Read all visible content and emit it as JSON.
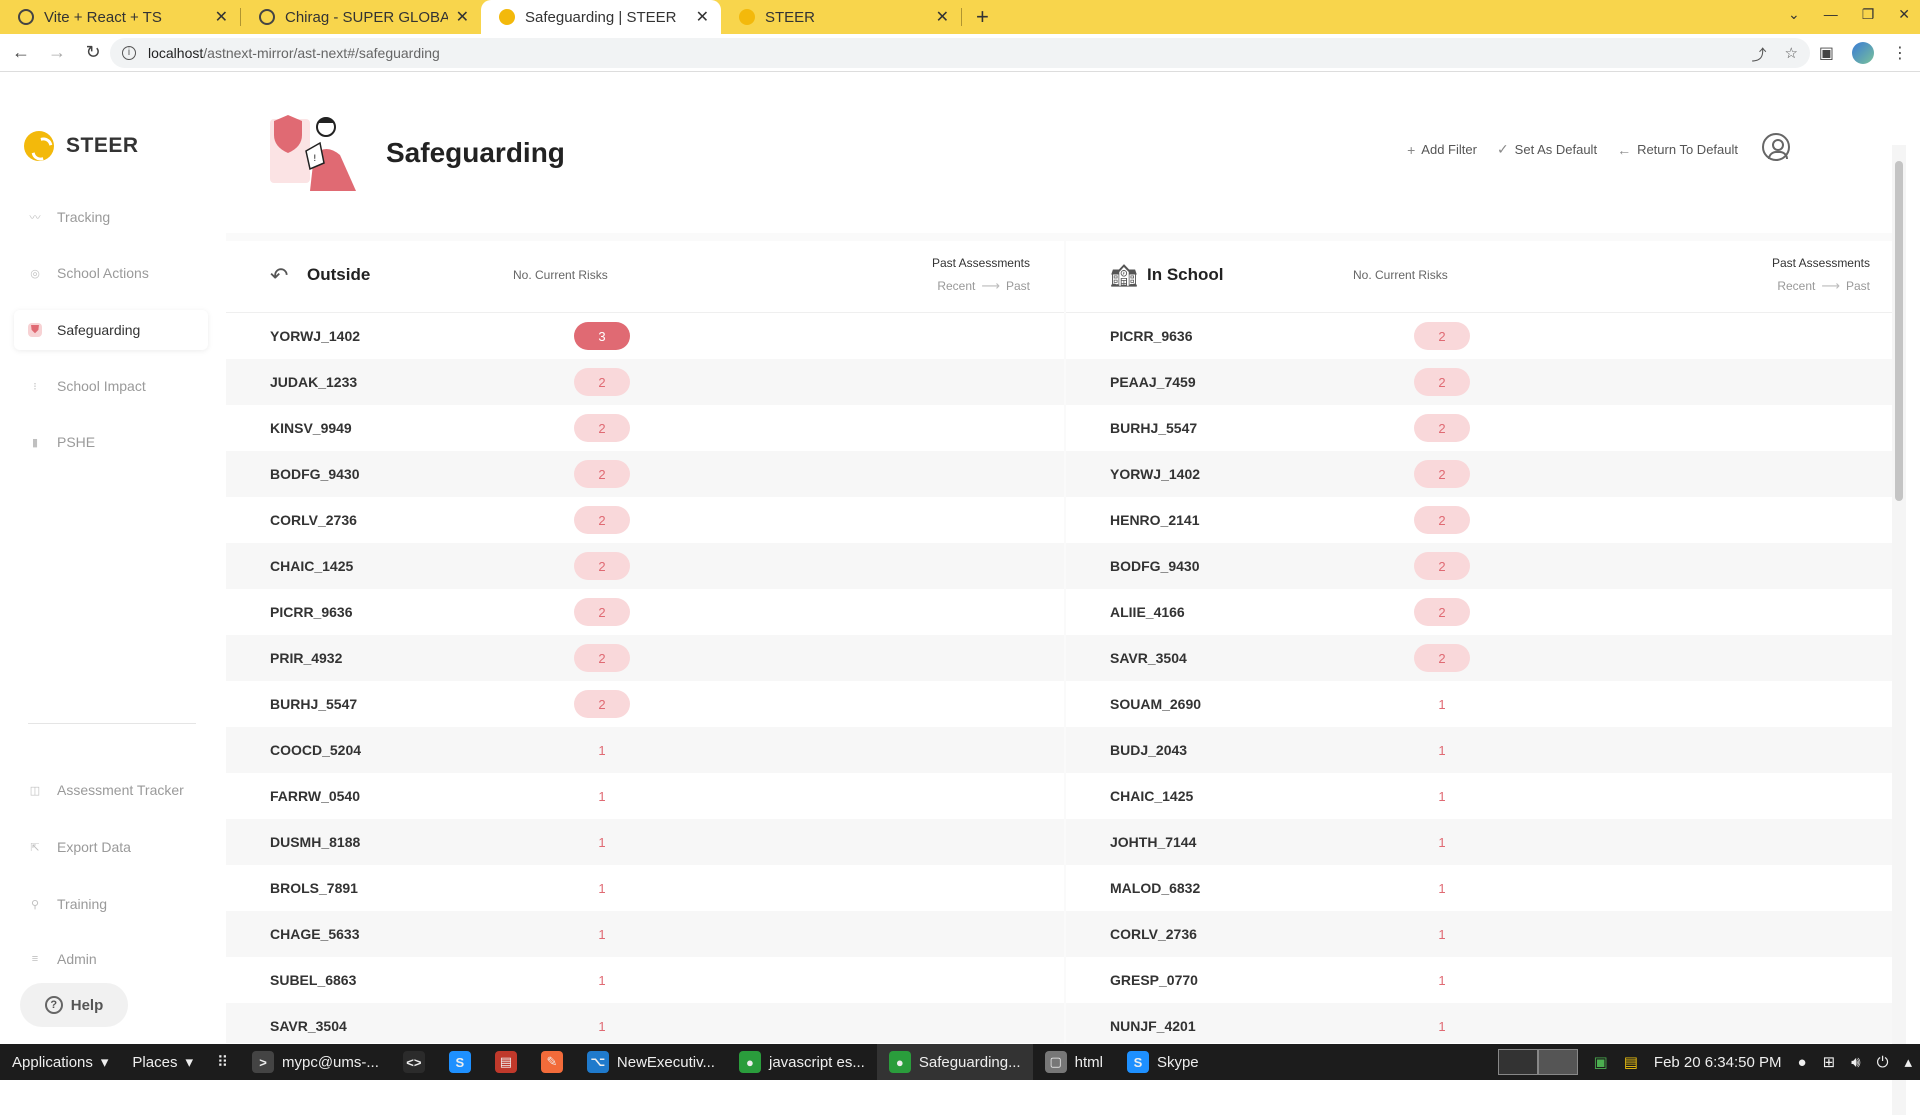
{
  "browser": {
    "tabs": [
      {
        "title": "Vite + React + TS",
        "icon": "globe-icon",
        "active": false
      },
      {
        "title": "Chirag - SUPER GLOBAL A",
        "icon": "globe-icon",
        "active": false
      },
      {
        "title": "Safeguarding | STEER",
        "icon": "steer-icon",
        "active": true
      },
      {
        "title": "STEER",
        "icon": "steer-icon",
        "active": false
      }
    ],
    "url_host": "localhost",
    "url_path": "/astnext-mirror/ast-next#/safeguarding"
  },
  "app": {
    "logo_text": "STEER",
    "nav_top": [
      {
        "label": "Tracking",
        "icon": "tracking-icon",
        "active": false
      },
      {
        "label": "School Actions",
        "icon": "target-icon",
        "active": false
      },
      {
        "label": "Safeguarding",
        "icon": "shield-icon",
        "active": true
      },
      {
        "label": "School Impact",
        "icon": "chart-icon",
        "active": false
      },
      {
        "label": "PSHE",
        "icon": "book-icon",
        "active": false
      }
    ],
    "nav_bottom": [
      {
        "label": "Assessment Tracker",
        "icon": "tracker-icon"
      },
      {
        "label": "Export Data",
        "icon": "export-icon"
      },
      {
        "label": "Training",
        "icon": "training-icon"
      },
      {
        "label": "Admin",
        "icon": "menu-icon"
      }
    ],
    "help_label": "Help"
  },
  "page": {
    "title": "Safeguarding",
    "actions": {
      "add_filter": "Add Filter",
      "set_default": "Set As Default",
      "return_default": "Return To Default"
    }
  },
  "panels": {
    "outside": {
      "title": "Outside",
      "current_risks_label": "No. Current Risks",
      "past_label": "Past Assessments",
      "recent_label": "Recent",
      "past_sub_label": "Past",
      "rows": [
        {
          "code": "YORWJ_1402",
          "risks": "3"
        },
        {
          "code": "JUDAK_1233",
          "risks": "2"
        },
        {
          "code": "KINSV_9949",
          "risks": "2"
        },
        {
          "code": "BODFG_9430",
          "risks": "2"
        },
        {
          "code": "CORLV_2736",
          "risks": "2"
        },
        {
          "code": "CHAIC_1425",
          "risks": "2"
        },
        {
          "code": "PICRR_9636",
          "risks": "2"
        },
        {
          "code": "PRIR_4932",
          "risks": "2"
        },
        {
          "code": "BURHJ_5547",
          "risks": "2"
        },
        {
          "code": "COOCD_5204",
          "risks": "1"
        },
        {
          "code": "FARRW_0540",
          "risks": "1"
        },
        {
          "code": "DUSMH_8188",
          "risks": "1"
        },
        {
          "code": "BROLS_7891",
          "risks": "1"
        },
        {
          "code": "CHAGE_5633",
          "risks": "1"
        },
        {
          "code": "SUBEL_6863",
          "risks": "1"
        },
        {
          "code": "SAVR_3504",
          "risks": "1"
        }
      ]
    },
    "inschool": {
      "title": "In School",
      "current_risks_label": "No. Current Risks",
      "past_label": "Past Assessments",
      "recent_label": "Recent",
      "past_sub_label": "Past",
      "rows": [
        {
          "code": "PICRR_9636",
          "risks": "2"
        },
        {
          "code": "PEAAJ_7459",
          "risks": "2"
        },
        {
          "code": "BURHJ_5547",
          "risks": "2"
        },
        {
          "code": "YORWJ_1402",
          "risks": "2"
        },
        {
          "code": "HENRO_2141",
          "risks": "2"
        },
        {
          "code": "BODFG_9430",
          "risks": "2"
        },
        {
          "code": "ALIIE_4166",
          "risks": "2"
        },
        {
          "code": "SAVR_3504",
          "risks": "2"
        },
        {
          "code": "SOUAM_2690",
          "risks": "1"
        },
        {
          "code": "BUDJ_2043",
          "risks": "1"
        },
        {
          "code": "CHAIC_1425",
          "risks": "1"
        },
        {
          "code": "JOHTH_7144",
          "risks": "1"
        },
        {
          "code": "MALOD_6832",
          "risks": "1"
        },
        {
          "code": "CORLV_2736",
          "risks": "1"
        },
        {
          "code": "GRESP_0770",
          "risks": "1"
        },
        {
          "code": "NUNJF_4201",
          "risks": "1"
        }
      ]
    }
  },
  "taskbar": {
    "applications": "Applications",
    "places": "Places",
    "items": [
      {
        "label": "mypc@ums-...",
        "color": "#444444",
        "glyph": "&gt;"
      },
      {
        "label": "",
        "color": "#2b2b2b",
        "glyph": "&lt;&gt;"
      },
      {
        "label": "",
        "color": "#1e90ff",
        "glyph": "S"
      },
      {
        "label": "",
        "color": "#c0392b",
        "glyph": "▤"
      },
      {
        "label": "",
        "color": "#f26b3a",
        "glyph": "✎"
      },
      {
        "label": "NewExecutiv...",
        "color": "#1f7acc",
        "glyph": "⌥"
      },
      {
        "label": "javascript es...",
        "color": "#2a9d3c",
        "glyph": "●"
      },
      {
        "label": "Safeguarding...",
        "color": "#2a9d3c",
        "glyph": "●"
      },
      {
        "label": "html",
        "color": "#777777",
        "glyph": "▢"
      },
      {
        "label": "Skype",
        "color": "#1e90ff",
        "glyph": "S"
      }
    ],
    "clock": "Feb 20  6:34:50 PM"
  },
  "colors": {
    "accent": "#e06a73",
    "accent_light": "#f9d8da",
    "tabbar": "#f8d54c",
    "brand": "#f3b90b"
  }
}
